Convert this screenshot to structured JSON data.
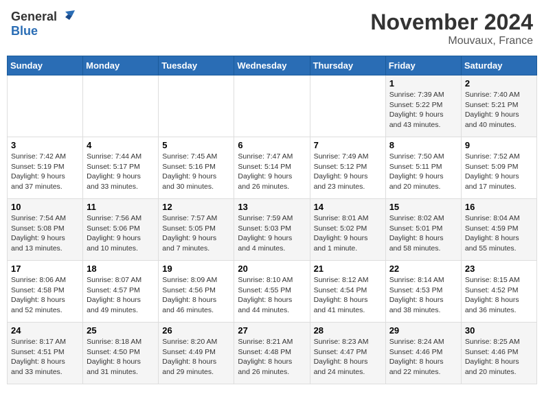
{
  "logo": {
    "general": "General",
    "blue": "Blue"
  },
  "title": "November 2024",
  "location": "Mouvaux, France",
  "days_of_week": [
    "Sunday",
    "Monday",
    "Tuesday",
    "Wednesday",
    "Thursday",
    "Friday",
    "Saturday"
  ],
  "weeks": [
    [
      {
        "day": "",
        "sunrise": "",
        "sunset": "",
        "daylight": ""
      },
      {
        "day": "",
        "sunrise": "",
        "sunset": "",
        "daylight": ""
      },
      {
        "day": "",
        "sunrise": "",
        "sunset": "",
        "daylight": ""
      },
      {
        "day": "",
        "sunrise": "",
        "sunset": "",
        "daylight": ""
      },
      {
        "day": "",
        "sunrise": "",
        "sunset": "",
        "daylight": ""
      },
      {
        "day": "1",
        "sunrise": "Sunrise: 7:39 AM",
        "sunset": "Sunset: 5:22 PM",
        "daylight": "Daylight: 9 hours and 43 minutes."
      },
      {
        "day": "2",
        "sunrise": "Sunrise: 7:40 AM",
        "sunset": "Sunset: 5:21 PM",
        "daylight": "Daylight: 9 hours and 40 minutes."
      }
    ],
    [
      {
        "day": "3",
        "sunrise": "Sunrise: 7:42 AM",
        "sunset": "Sunset: 5:19 PM",
        "daylight": "Daylight: 9 hours and 37 minutes."
      },
      {
        "day": "4",
        "sunrise": "Sunrise: 7:44 AM",
        "sunset": "Sunset: 5:17 PM",
        "daylight": "Daylight: 9 hours and 33 minutes."
      },
      {
        "day": "5",
        "sunrise": "Sunrise: 7:45 AM",
        "sunset": "Sunset: 5:16 PM",
        "daylight": "Daylight: 9 hours and 30 minutes."
      },
      {
        "day": "6",
        "sunrise": "Sunrise: 7:47 AM",
        "sunset": "Sunset: 5:14 PM",
        "daylight": "Daylight: 9 hours and 26 minutes."
      },
      {
        "day": "7",
        "sunrise": "Sunrise: 7:49 AM",
        "sunset": "Sunset: 5:12 PM",
        "daylight": "Daylight: 9 hours and 23 minutes."
      },
      {
        "day": "8",
        "sunrise": "Sunrise: 7:50 AM",
        "sunset": "Sunset: 5:11 PM",
        "daylight": "Daylight: 9 hours and 20 minutes."
      },
      {
        "day": "9",
        "sunrise": "Sunrise: 7:52 AM",
        "sunset": "Sunset: 5:09 PM",
        "daylight": "Daylight: 9 hours and 17 minutes."
      }
    ],
    [
      {
        "day": "10",
        "sunrise": "Sunrise: 7:54 AM",
        "sunset": "Sunset: 5:08 PM",
        "daylight": "Daylight: 9 hours and 13 minutes."
      },
      {
        "day": "11",
        "sunrise": "Sunrise: 7:56 AM",
        "sunset": "Sunset: 5:06 PM",
        "daylight": "Daylight: 9 hours and 10 minutes."
      },
      {
        "day": "12",
        "sunrise": "Sunrise: 7:57 AM",
        "sunset": "Sunset: 5:05 PM",
        "daylight": "Daylight: 9 hours and 7 minutes."
      },
      {
        "day": "13",
        "sunrise": "Sunrise: 7:59 AM",
        "sunset": "Sunset: 5:03 PM",
        "daylight": "Daylight: 9 hours and 4 minutes."
      },
      {
        "day": "14",
        "sunrise": "Sunrise: 8:01 AM",
        "sunset": "Sunset: 5:02 PM",
        "daylight": "Daylight: 9 hours and 1 minute."
      },
      {
        "day": "15",
        "sunrise": "Sunrise: 8:02 AM",
        "sunset": "Sunset: 5:01 PM",
        "daylight": "Daylight: 8 hours and 58 minutes."
      },
      {
        "day": "16",
        "sunrise": "Sunrise: 8:04 AM",
        "sunset": "Sunset: 4:59 PM",
        "daylight": "Daylight: 8 hours and 55 minutes."
      }
    ],
    [
      {
        "day": "17",
        "sunrise": "Sunrise: 8:06 AM",
        "sunset": "Sunset: 4:58 PM",
        "daylight": "Daylight: 8 hours and 52 minutes."
      },
      {
        "day": "18",
        "sunrise": "Sunrise: 8:07 AM",
        "sunset": "Sunset: 4:57 PM",
        "daylight": "Daylight: 8 hours and 49 minutes."
      },
      {
        "day": "19",
        "sunrise": "Sunrise: 8:09 AM",
        "sunset": "Sunset: 4:56 PM",
        "daylight": "Daylight: 8 hours and 46 minutes."
      },
      {
        "day": "20",
        "sunrise": "Sunrise: 8:10 AM",
        "sunset": "Sunset: 4:55 PM",
        "daylight": "Daylight: 8 hours and 44 minutes."
      },
      {
        "day": "21",
        "sunrise": "Sunrise: 8:12 AM",
        "sunset": "Sunset: 4:54 PM",
        "daylight": "Daylight: 8 hours and 41 minutes."
      },
      {
        "day": "22",
        "sunrise": "Sunrise: 8:14 AM",
        "sunset": "Sunset: 4:53 PM",
        "daylight": "Daylight: 8 hours and 38 minutes."
      },
      {
        "day": "23",
        "sunrise": "Sunrise: 8:15 AM",
        "sunset": "Sunset: 4:52 PM",
        "daylight": "Daylight: 8 hours and 36 minutes."
      }
    ],
    [
      {
        "day": "24",
        "sunrise": "Sunrise: 8:17 AM",
        "sunset": "Sunset: 4:51 PM",
        "daylight": "Daylight: 8 hours and 33 minutes."
      },
      {
        "day": "25",
        "sunrise": "Sunrise: 8:18 AM",
        "sunset": "Sunset: 4:50 PM",
        "daylight": "Daylight: 8 hours and 31 minutes."
      },
      {
        "day": "26",
        "sunrise": "Sunrise: 8:20 AM",
        "sunset": "Sunset: 4:49 PM",
        "daylight": "Daylight: 8 hours and 29 minutes."
      },
      {
        "day": "27",
        "sunrise": "Sunrise: 8:21 AM",
        "sunset": "Sunset: 4:48 PM",
        "daylight": "Daylight: 8 hours and 26 minutes."
      },
      {
        "day": "28",
        "sunrise": "Sunrise: 8:23 AM",
        "sunset": "Sunset: 4:47 PM",
        "daylight": "Daylight: 8 hours and 24 minutes."
      },
      {
        "day": "29",
        "sunrise": "Sunrise: 8:24 AM",
        "sunset": "Sunset: 4:46 PM",
        "daylight": "Daylight: 8 hours and 22 minutes."
      },
      {
        "day": "30",
        "sunrise": "Sunrise: 8:25 AM",
        "sunset": "Sunset: 4:46 PM",
        "daylight": "Daylight: 8 hours and 20 minutes."
      }
    ]
  ]
}
